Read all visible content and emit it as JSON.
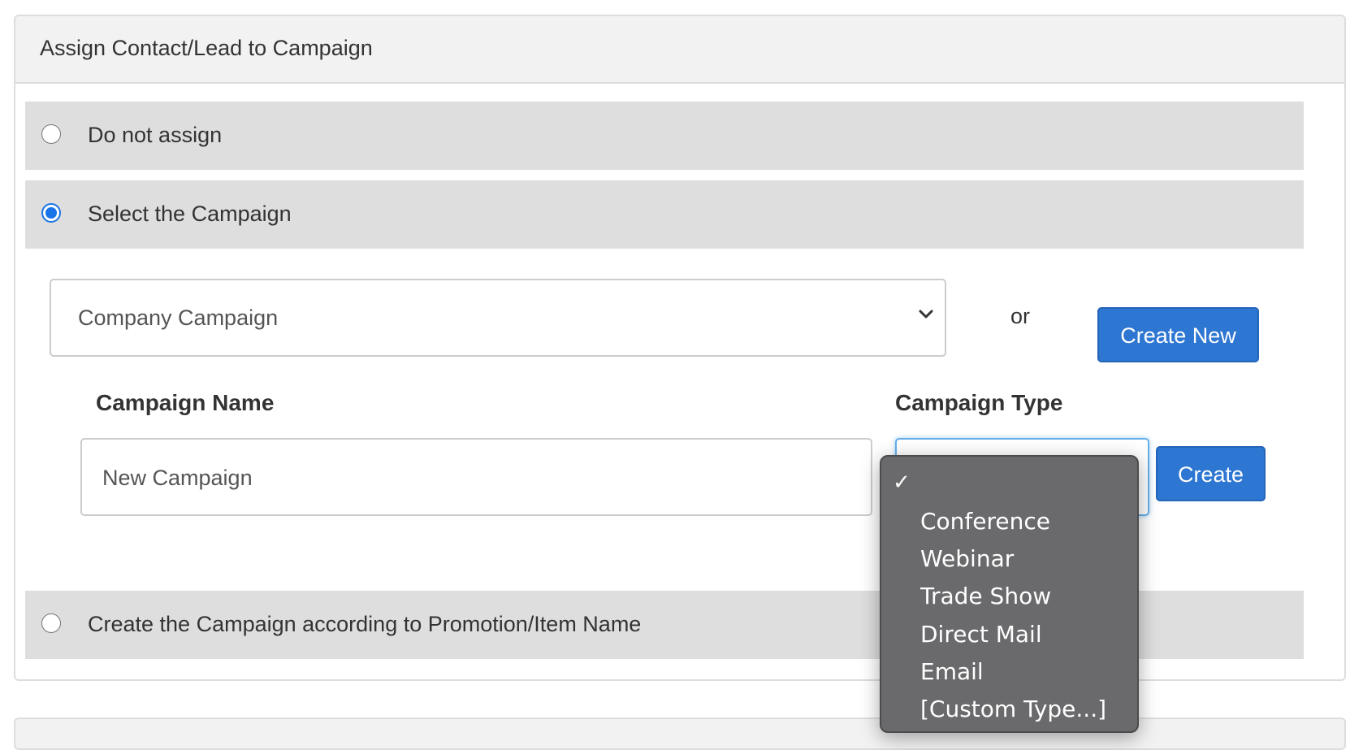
{
  "panel": {
    "title": "Assign Contact/Lead to Campaign"
  },
  "options": {
    "do_not_assign": "Do not assign",
    "select_campaign": "Select the Campaign",
    "by_promotion": "Create the Campaign according to Promotion/Item Name"
  },
  "selected_option": "select_campaign",
  "campaign_select": {
    "value": "Company Campaign"
  },
  "or_text": "or",
  "create_new_label": "Create New",
  "campaign_name": {
    "label": "Campaign Name",
    "value": "New Campaign"
  },
  "campaign_type": {
    "label": "Campaign Type",
    "selected": "",
    "options": [
      "Conference",
      "Webinar",
      "Trade Show",
      "Direct Mail",
      "Email",
      "[Custom Type...]"
    ]
  },
  "create_label": "Create",
  "colors": {
    "primary": "#2d76d2",
    "radio_checked": "#1a73e8",
    "row_bg": "#dedede",
    "dropdown_bg": "#6a6a6c"
  }
}
